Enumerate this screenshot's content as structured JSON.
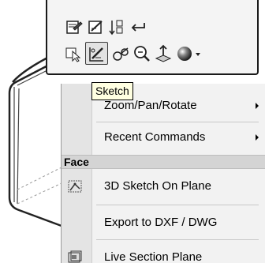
{
  "toolbar": {
    "row1": [
      {
        "icon": "rebuild-icon"
      },
      {
        "icon": "edit-sketch-icon"
      },
      {
        "icon": "sort-icon"
      },
      {
        "icon": "return-icon"
      }
    ],
    "row2": [
      {
        "icon": "select-icon"
      },
      {
        "icon": "sketch-icon",
        "selected": true
      },
      {
        "icon": "smart-dimension-icon"
      },
      {
        "icon": "zoom-icon"
      },
      {
        "icon": "normal-to-icon"
      },
      {
        "icon": "appearance-icon"
      }
    ]
  },
  "tooltip": {
    "text": "Sketch"
  },
  "menu": {
    "items_top": [
      {
        "label": "Zoom/Pan/Rotate",
        "submenu": true
      },
      {
        "label": "Recent Commands",
        "submenu": true
      }
    ],
    "section": {
      "title": "Face"
    },
    "items_bottom": [
      {
        "label": "3D Sketch On Plane",
        "icon": "3d-sketch-icon"
      },
      {
        "label": "Export to DXF / DWG",
        "icon": ""
      },
      {
        "label": "Live Section Plane",
        "icon": "live-section-icon"
      }
    ]
  },
  "colors": {
    "menu_bg": "#f2f2f2",
    "gutter_bg": "#e4e4e4",
    "tooltip_bg": "#ffffe1",
    "header_bg": "#d4d4d4"
  }
}
